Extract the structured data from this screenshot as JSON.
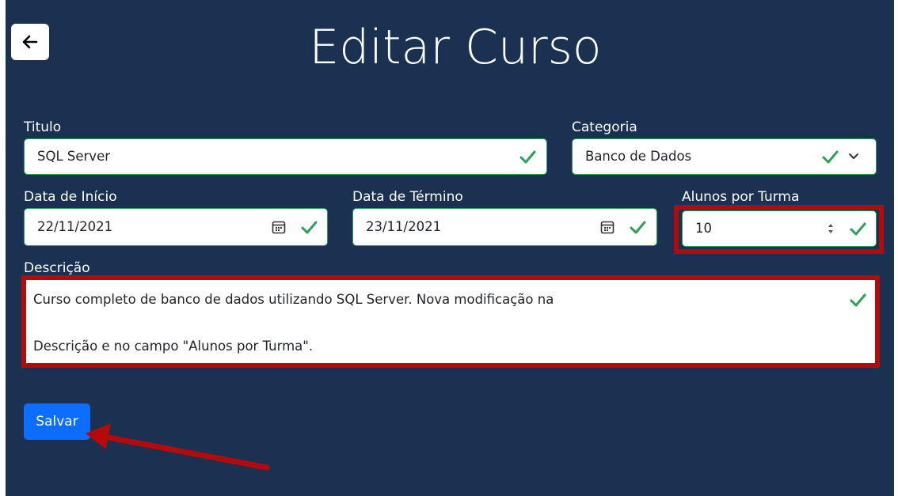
{
  "page": {
    "title": "Editar Curso",
    "back_icon": "arrow-left-icon"
  },
  "form": {
    "titulo": {
      "label": "Titulo",
      "value": "SQL Server"
    },
    "categoria": {
      "label": "Categoria",
      "value": "Banco de Dados"
    },
    "data_inicio": {
      "label": "Data de Início",
      "value": "22/11/2021"
    },
    "data_termino": {
      "label": "Data de Término",
      "value": "23/11/2021"
    },
    "alunos": {
      "label": "Alunos por Turma",
      "value": "10"
    },
    "descricao": {
      "label": "Descrição",
      "line1": "Curso completo de banco de dados utilizando SQL Server. Nova modificação na",
      "line2": "Descrição e no campo \"Alunos por Turma\"."
    }
  },
  "actions": {
    "save_label": "Salvar"
  },
  "colors": {
    "background": "#1b3152",
    "valid": "#2c9f5a",
    "primary": "#0d6efd",
    "annotation": "#b50a0a"
  }
}
